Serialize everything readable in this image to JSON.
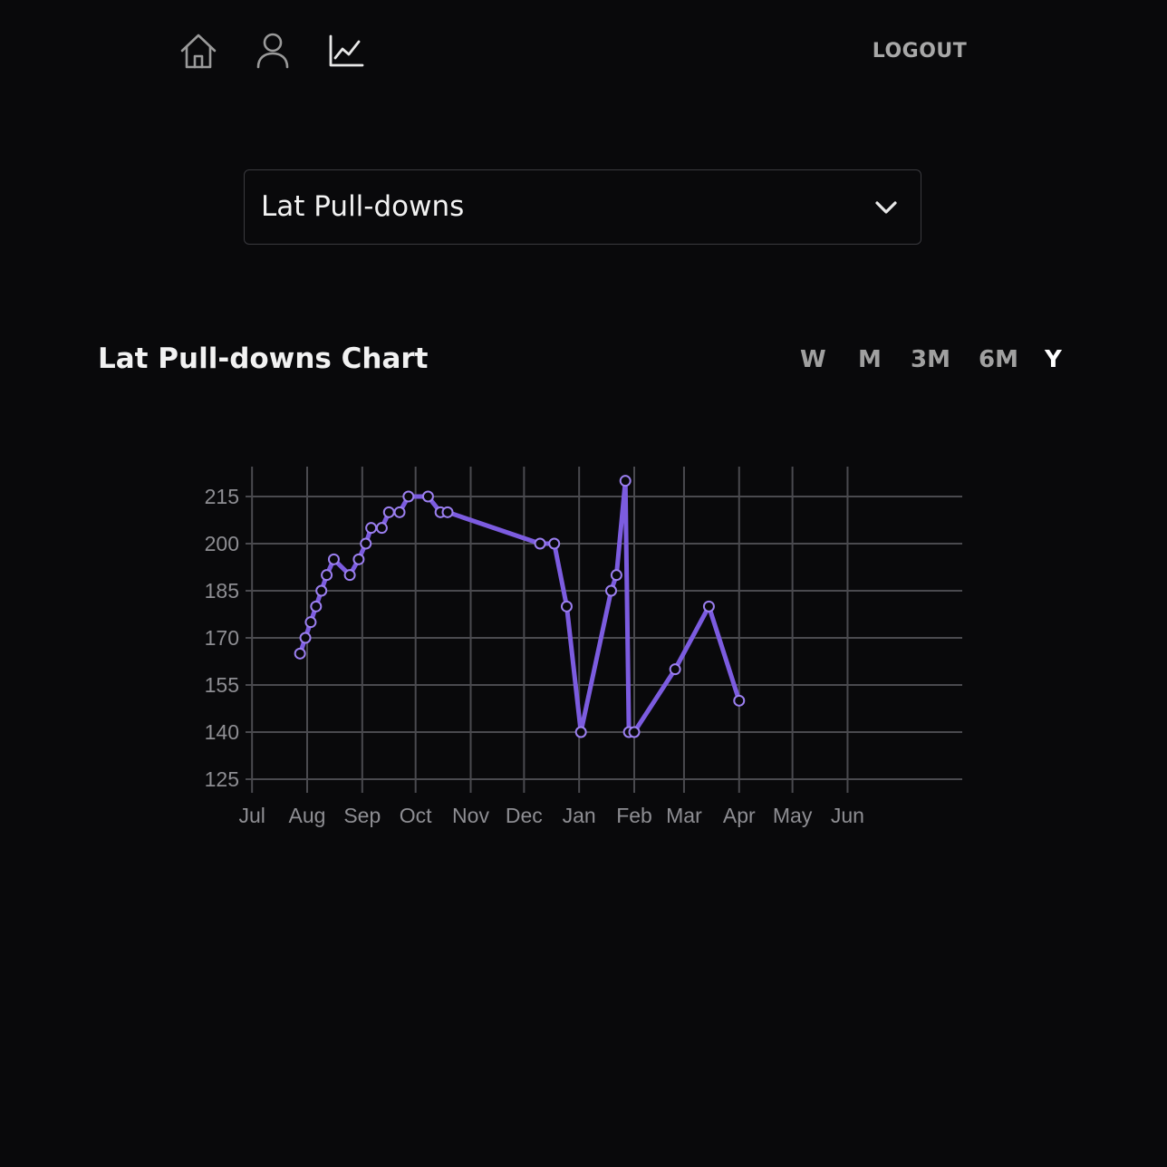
{
  "nav": {
    "icons": [
      "home-icon",
      "user-icon",
      "chart-icon"
    ],
    "logout_label": "LOGOUT"
  },
  "exercise_select": {
    "value": "Lat Pull-downs"
  },
  "chart_section": {
    "title": "Lat Pull-downs Chart",
    "ranges": [
      "W",
      "M",
      "3M",
      "6M",
      "Y"
    ],
    "active_range": "Y"
  },
  "colors": {
    "background": "#09090b",
    "line": "#7c5ce0",
    "grid": "#4a4a4f",
    "active_range": "#ffffff",
    "inactive_range": "#a0a0a0"
  },
  "chart_data": {
    "type": "line",
    "title": "",
    "xlabel": "",
    "ylabel": "",
    "y_ticks": [
      215,
      200,
      185,
      170,
      155,
      140,
      125
    ],
    "ylim": [
      125,
      225
    ],
    "x_ticks": [
      "Aug",
      "Sep",
      "Oct",
      "Nov",
      "Dec",
      "Jan",
      "Feb",
      "Mar",
      "Apr",
      "May",
      "Jun",
      "Jul"
    ],
    "grid": true,
    "series": [
      {
        "x": [
          "Jul 28",
          "Jul 31",
          "Aug 3",
          "Aug 6",
          "Aug 9",
          "Aug 12",
          "Aug 16",
          "Aug 25",
          "Aug 30",
          "Sep 3",
          "Sep 6",
          "Sep 12",
          "Sep 16",
          "Sep 22",
          "Sep 27",
          "Oct 8",
          "Oct 15",
          "Oct 19",
          "Dec 10",
          "Dec 18",
          "Dec 25",
          "Jan 2",
          "Jan 19",
          "Jan 22",
          "Jan 27",
          "Jan 29",
          "Feb 1",
          "Feb 24",
          "Mar 15",
          "Apr 1"
        ],
        "values": [
          165,
          170,
          175,
          180,
          185,
          190,
          195,
          190,
          195,
          200,
          205,
          205,
          210,
          210,
          215,
          215,
          210,
          210,
          200,
          200,
          180,
          140,
          185,
          190,
          220,
          140,
          140,
          160,
          180,
          150
        ]
      }
    ]
  }
}
